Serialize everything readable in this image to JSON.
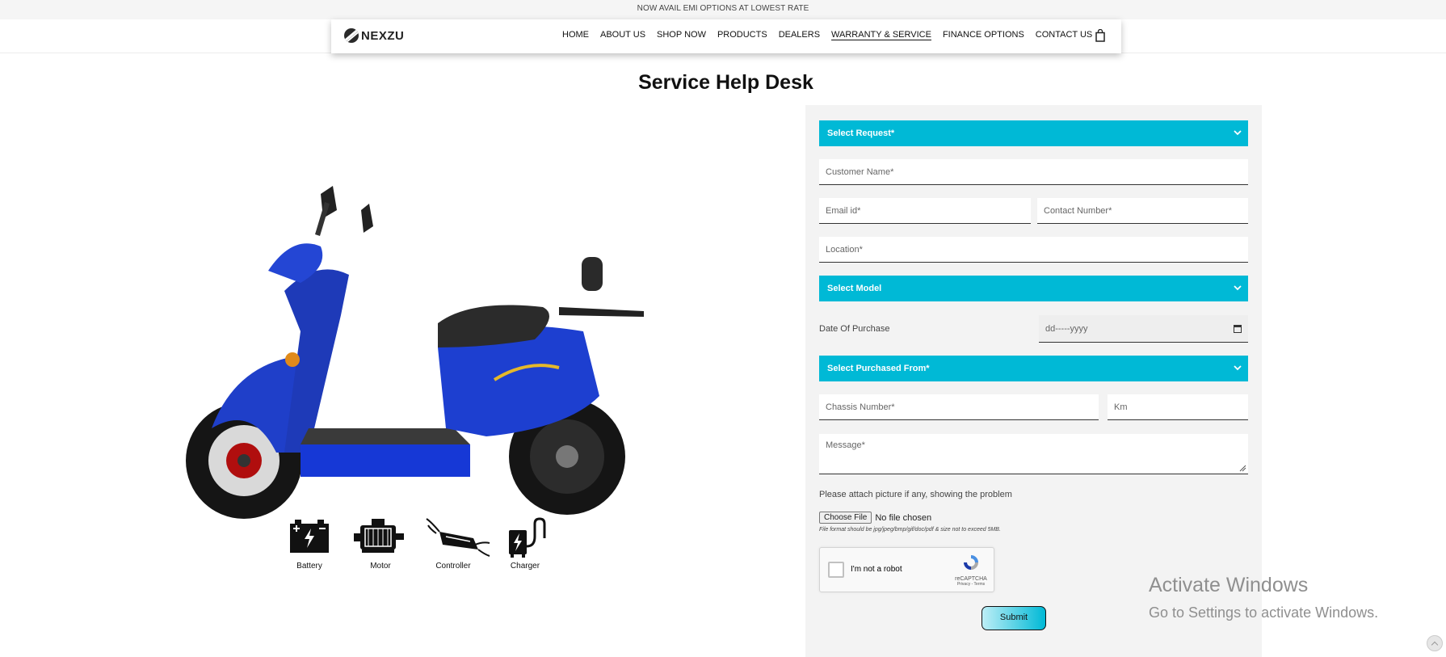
{
  "announcement": "NOW AVAIL EMI OPTIONS AT LOWEST RATE",
  "brand": {
    "logo_text": "NEXZU"
  },
  "nav": {
    "items": [
      {
        "label": "HOME"
      },
      {
        "label": "ABOUT US"
      },
      {
        "label": "SHOP NOW"
      },
      {
        "label": "PRODUCTS"
      },
      {
        "label": "DEALERS"
      },
      {
        "label": "WARRANTY & SERVICE",
        "active": true
      },
      {
        "label": "FINANCE OPTIONS"
      },
      {
        "label": "CONTACT US"
      }
    ],
    "cart_icon": "shopping-bag-icon"
  },
  "page_title": "Service Help Desk",
  "parts": [
    {
      "label": "Battery",
      "icon": "battery-icon"
    },
    {
      "label": "Motor",
      "icon": "motor-icon"
    },
    {
      "label": "Controller",
      "icon": "controller-icon"
    },
    {
      "label": "Charger",
      "icon": "charger-icon"
    }
  ],
  "form": {
    "select_request": "Select Request*",
    "customer_name": "Customer Name*",
    "email": "Email id*",
    "contact": "Contact Number*",
    "location": "Location*",
    "select_model": "Select Model",
    "date_label": "Date Of Purchase",
    "date_placeholder": "dd-----yyyy",
    "select_purchased_from": "Select Purchased From*",
    "chassis": "Chassis Number*",
    "km": "Km",
    "message": "Message*",
    "attach_label": "Please attach picture if any, showing the problem",
    "choose_file": "Choose File",
    "no_file": "No file chosen",
    "file_hint": "File format should be jpg/jpeg/bmp/gif/doc/pdf & size not to exceed 5MB.",
    "captcha_label": "I'm not a robot",
    "captcha_brand": "reCAPTCHA",
    "captcha_terms": "Privacy - Terms",
    "submit": "Submit"
  },
  "colors": {
    "accent": "#00b9d6"
  },
  "watermark": {
    "line1": "Activate Windows",
    "line2": "Go to Settings to activate Windows."
  }
}
